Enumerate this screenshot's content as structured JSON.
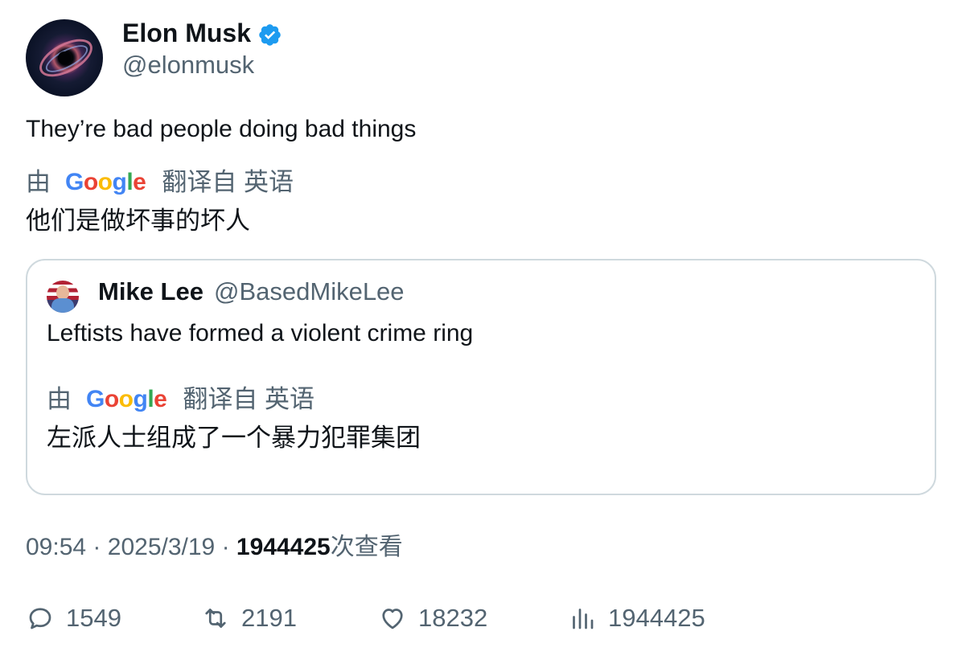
{
  "author": {
    "name": "Elon Musk",
    "handle": "@elonmusk",
    "verified": true,
    "avatar_icon": "black-hole-avatar"
  },
  "tweet": {
    "text": "They’re bad people doing bad things",
    "translation": {
      "by_label": "由",
      "provider": "Google",
      "source_label": "翻译自 英语",
      "text": "他们是做坏事的坏人"
    }
  },
  "quoted_tweet": {
    "author_name": "Mike Lee",
    "author_handle": "@BasedMikeLee",
    "text": "Leftists have formed a violent crime ring",
    "translation": {
      "by_label": "由",
      "provider": "Google",
      "source_label": "翻译自 英语",
      "text": "左派人士组成了一个暴力犯罪集团"
    }
  },
  "meta": {
    "time": "09:54",
    "separator": "·",
    "date": "2025/3/19",
    "views_count": "1944425",
    "views_label": "次查看"
  },
  "actions": {
    "replies": "1549",
    "reposts": "2191",
    "likes": "18232",
    "views": "1944425"
  },
  "colors": {
    "verified_blue": "#1d9bf0",
    "secondary_text": "#536471",
    "primary_text": "#0f1419",
    "border": "#cfd9de"
  }
}
